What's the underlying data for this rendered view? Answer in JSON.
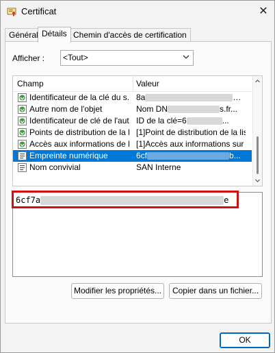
{
  "window": {
    "title": "Certificat",
    "close_glyph": "✕"
  },
  "tabs": [
    {
      "label": "Général",
      "active": false
    },
    {
      "label": "Détails",
      "active": true
    },
    {
      "label": "Chemin d'accès de certification",
      "active": false
    }
  ],
  "show": {
    "label": "Afficher :",
    "selected": "<Tout>"
  },
  "fields_list": {
    "headers": {
      "field": "Champ",
      "value": "Valeur"
    },
    "rows": [
      {
        "field": "Identificateur de la clé du s...",
        "value_prefix": "8a",
        "value_suffix": "…",
        "icon": "certificate-extension-icon",
        "selected": false
      },
      {
        "field": "Autre nom de l'objet",
        "value_prefix": "Nom DN",
        "value_suffix": "s.fr...",
        "icon": "certificate-extension-icon",
        "selected": false
      },
      {
        "field": "Identificateur de clé de l'aut...",
        "value_prefix": "ID de la clé=6",
        "value_suffix": "...",
        "icon": "certificate-extension-icon",
        "selected": false
      },
      {
        "field": "Points de distribution de la li...",
        "value_prefix": "[1]Point de distribution de la lis...",
        "value_suffix": "",
        "icon": "certificate-extension-icon",
        "selected": false
      },
      {
        "field": "Accès aux informations de l'...",
        "value_prefix": "[1]Accès aux informations sur ...",
        "value_suffix": "",
        "icon": "certificate-extension-icon",
        "selected": false
      },
      {
        "field": "Empreinte numérique",
        "value_prefix": "6cf",
        "value_suffix": "b...",
        "icon": "certificate-field-icon",
        "selected": true
      },
      {
        "field": "Nom convivial",
        "value_prefix": "SAN Interne",
        "value_suffix": "",
        "icon": "certificate-field-icon",
        "selected": false
      }
    ]
  },
  "detail": {
    "value_prefix": "6cf7a",
    "value_suffix": "e"
  },
  "buttons": {
    "edit_properties": "Modifier les propriétés...",
    "copy_to_file": "Copier dans un fichier...",
    "ok": "OK"
  },
  "colors": {
    "selection": "#0078d7",
    "highlight_border": "#d01010"
  }
}
